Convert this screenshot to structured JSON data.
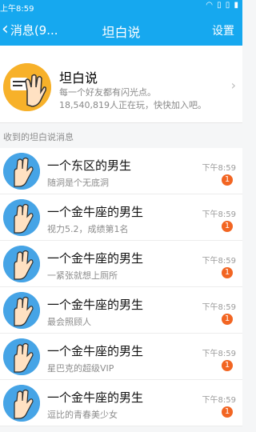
{
  "status_bar": {
    "time": "上午8:59",
    "icons": "◠ ▯ ▯ ▮"
  },
  "nav": {
    "back_label": "消息(9...",
    "title": "坦白说",
    "settings_label": "设置"
  },
  "banner": {
    "title": "坦白说",
    "line1": "每一个好友都有闪光点。",
    "line2": "18,540,819人正在玩，快快加入吧。"
  },
  "section_header": "收到的坦白说消息",
  "items": [
    {
      "name": "一个东区的男生",
      "message": "随洞是个无底洞",
      "time": "下午8:59",
      "badge": "1"
    },
    {
      "name": "一个金牛座的男生",
      "message": "视力5.2，成绩第1名",
      "time": "下午8:59",
      "badge": "1"
    },
    {
      "name": "一个金牛座的男生",
      "message": "一紧张就想上厕所",
      "time": "下午8:59",
      "badge": "1"
    },
    {
      "name": "一个金牛座的男生",
      "message": "最会照顾人",
      "time": "下午8:59",
      "badge": "1"
    },
    {
      "name": "一个金牛座的男生",
      "message": "星巴克的超级VIP",
      "time": "下午8:59",
      "badge": "1"
    },
    {
      "name": "一个金牛座的男生",
      "message": "逗比的青春美少女",
      "time": "下午8:59",
      "badge": "1"
    }
  ],
  "colors": {
    "header": "#16a8ef",
    "badge": "#f26522",
    "avatar_banner": "#f7b12a",
    "avatar_item": "#46a4e6"
  }
}
